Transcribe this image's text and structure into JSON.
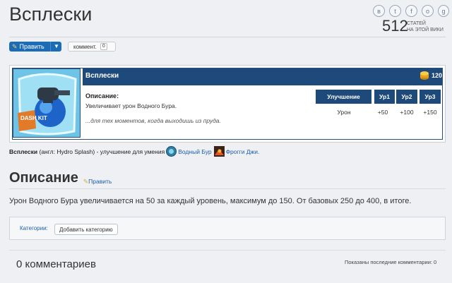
{
  "page": {
    "title": "Всплески",
    "article_count": "512",
    "article_count_label_line1": "СТАТЕЙ",
    "article_count_label_line2": "НА ЭТОЙ ВИКИ"
  },
  "social": [
    "vk-icon",
    "twitter-icon",
    "facebook-icon",
    "odnoklassniki-icon",
    "google-plus-icon"
  ],
  "social_glyphs": [
    "в",
    "t",
    "f",
    "о",
    "g"
  ],
  "toolbar": {
    "edit_label": "Править",
    "comment_label": "коммент.",
    "comment_count": "0"
  },
  "infobox": {
    "name": "Всплески",
    "cost": "120",
    "description_heading": "Описание:",
    "description": "Увеличивает урон Водного Бура.",
    "flavor": "...для тех моментов, когда выходишь из пруда.",
    "table": {
      "headers": [
        "Улучшение",
        "Ур1",
        "Ур2",
        "Ур3"
      ],
      "row": [
        "Урон",
        "+50",
        "+100",
        "+150"
      ]
    },
    "icon_text": "DASH KIT"
  },
  "intro": {
    "name": "Всплески",
    "english": "(англ: Hydro Splash)",
    "text_mid": "- улучшение для умения",
    "ability_link": "Водный Бур",
    "character_link": "Фрогги Джи."
  },
  "section": {
    "title": "Описание",
    "edit_label": "Править",
    "body": "Урон Водного Бура увеличивается на 50 за каждый уровень, максимум до 150. От базовых 250 до 400,  в итоге."
  },
  "categories": {
    "label": "Категории:",
    "add_button": "Добавить категорию"
  },
  "comments": {
    "count_label": "0 комментариев",
    "shown_label": "Показаны последние комментарии: 0"
  },
  "colors": {
    "header_blue": "#1e4a7b",
    "button_blue": "#1b6cb7",
    "link_blue": "#1e5fa8",
    "gold": "#f2b632"
  }
}
